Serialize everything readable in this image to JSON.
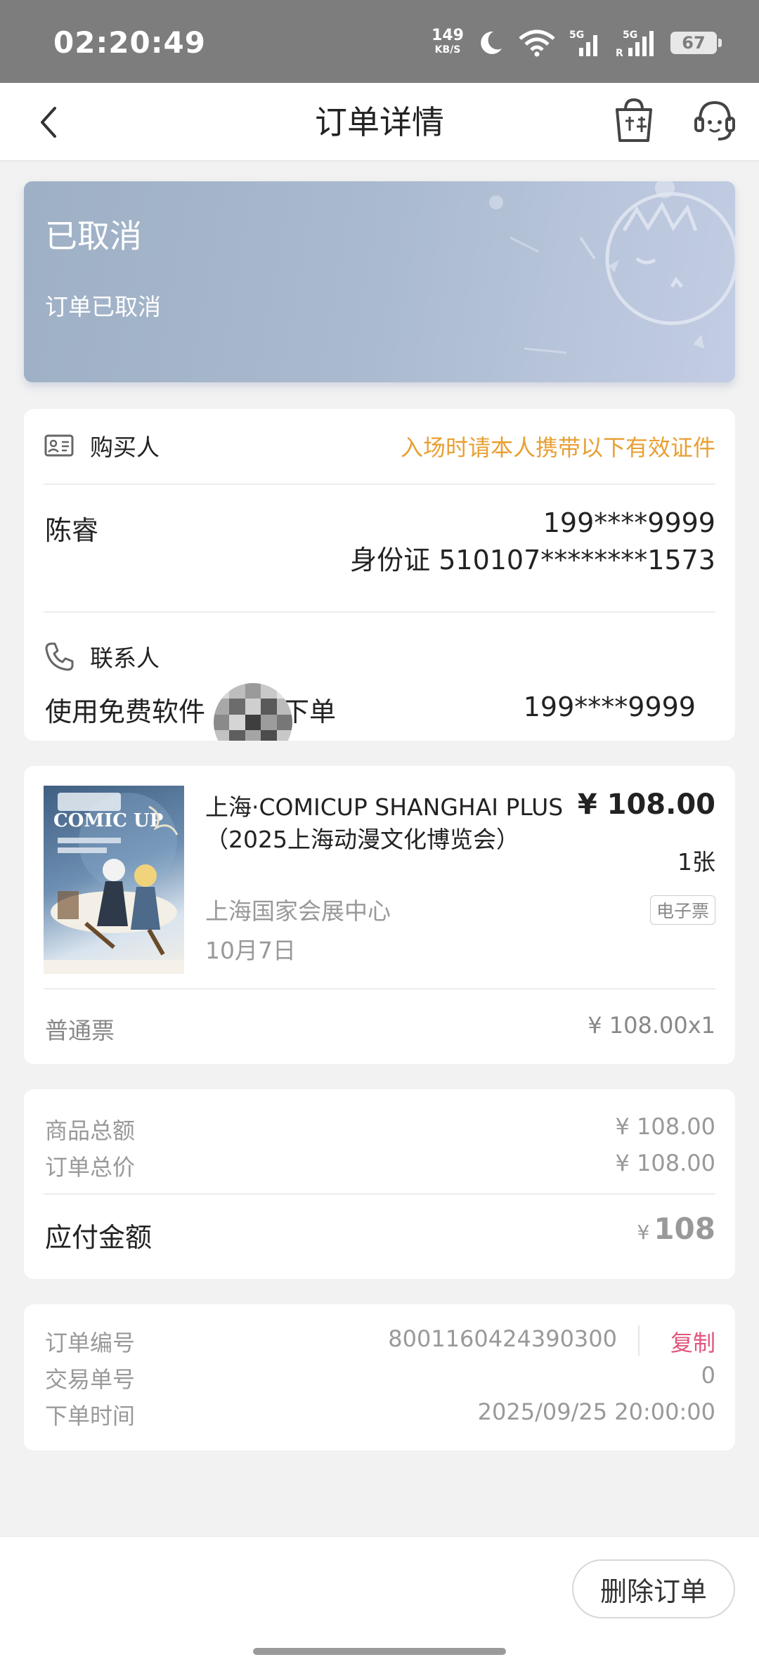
{
  "status_bar": {
    "time": "02:20:49",
    "net_speed": "149",
    "net_unit": "KB/S",
    "battery": "67"
  },
  "nav": {
    "title": "订单详情"
  },
  "order_status": {
    "title": "已取消",
    "subtitle": "订单已取消"
  },
  "buyer": {
    "section_label": "购买人",
    "note": "入场时请本人携带以下有效证件",
    "name": "陈睿",
    "phone": "199****9999",
    "id_text": "身份证  510107********1573"
  },
  "contact": {
    "section_label": "联系人",
    "name_left": "使用免费软件",
    "name_right": "下单",
    "phone": "199****9999"
  },
  "ticket": {
    "title": "上海·COMICUP SHANGHAI PLUS（2025上海动漫文化博览会）",
    "price": "¥ 108.00",
    "quantity": "1张",
    "venue": "上海国家会展中心",
    "type_tag": "电子票",
    "date": "10月7日",
    "ticket_type": "普通票",
    "unit_price": "¥ 108.00x1",
    "poster_text": "COMIC UP"
  },
  "summary": {
    "goods_total_label": "商品总额",
    "goods_total": "¥ 108.00",
    "order_total_label": "订单总价",
    "order_total": "¥ 108.00",
    "payable_label": "应付金额",
    "payable_currency": "¥",
    "payable_amount": "108"
  },
  "order_info": {
    "order_no_label": "订单编号",
    "order_no": "8001160424390300",
    "copy_label": "复制",
    "trade_no_label": "交易单号",
    "trade_no": "0",
    "order_time_label": "下单时间",
    "order_time": "2025/09/25 20:00:00"
  },
  "actions": {
    "delete_label": "删除订单"
  },
  "colors": {
    "accent_orange": "#e8a033",
    "copy_pink": "#e2557d",
    "status_card": "#a9b9ce"
  }
}
